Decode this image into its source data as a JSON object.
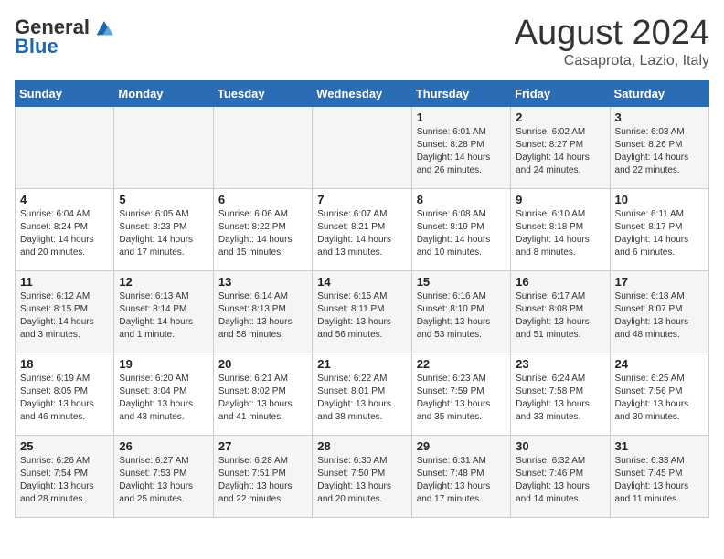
{
  "logo": {
    "general": "General",
    "blue": "Blue"
  },
  "title": "August 2024",
  "subtitle": "Casaprota, Lazio, Italy",
  "days_header": [
    "Sunday",
    "Monday",
    "Tuesday",
    "Wednesday",
    "Thursday",
    "Friday",
    "Saturday"
  ],
  "weeks": [
    [
      {
        "num": "",
        "info": ""
      },
      {
        "num": "",
        "info": ""
      },
      {
        "num": "",
        "info": ""
      },
      {
        "num": "",
        "info": ""
      },
      {
        "num": "1",
        "info": "Sunrise: 6:01 AM\nSunset: 8:28 PM\nDaylight: 14 hours and 26 minutes."
      },
      {
        "num": "2",
        "info": "Sunrise: 6:02 AM\nSunset: 8:27 PM\nDaylight: 14 hours and 24 minutes."
      },
      {
        "num": "3",
        "info": "Sunrise: 6:03 AM\nSunset: 8:26 PM\nDaylight: 14 hours and 22 minutes."
      }
    ],
    [
      {
        "num": "4",
        "info": "Sunrise: 6:04 AM\nSunset: 8:24 PM\nDaylight: 14 hours and 20 minutes."
      },
      {
        "num": "5",
        "info": "Sunrise: 6:05 AM\nSunset: 8:23 PM\nDaylight: 14 hours and 17 minutes."
      },
      {
        "num": "6",
        "info": "Sunrise: 6:06 AM\nSunset: 8:22 PM\nDaylight: 14 hours and 15 minutes."
      },
      {
        "num": "7",
        "info": "Sunrise: 6:07 AM\nSunset: 8:21 PM\nDaylight: 14 hours and 13 minutes."
      },
      {
        "num": "8",
        "info": "Sunrise: 6:08 AM\nSunset: 8:19 PM\nDaylight: 14 hours and 10 minutes."
      },
      {
        "num": "9",
        "info": "Sunrise: 6:10 AM\nSunset: 8:18 PM\nDaylight: 14 hours and 8 minutes."
      },
      {
        "num": "10",
        "info": "Sunrise: 6:11 AM\nSunset: 8:17 PM\nDaylight: 14 hours and 6 minutes."
      }
    ],
    [
      {
        "num": "11",
        "info": "Sunrise: 6:12 AM\nSunset: 8:15 PM\nDaylight: 14 hours and 3 minutes."
      },
      {
        "num": "12",
        "info": "Sunrise: 6:13 AM\nSunset: 8:14 PM\nDaylight: 14 hours and 1 minute."
      },
      {
        "num": "13",
        "info": "Sunrise: 6:14 AM\nSunset: 8:13 PM\nDaylight: 13 hours and 58 minutes."
      },
      {
        "num": "14",
        "info": "Sunrise: 6:15 AM\nSunset: 8:11 PM\nDaylight: 13 hours and 56 minutes."
      },
      {
        "num": "15",
        "info": "Sunrise: 6:16 AM\nSunset: 8:10 PM\nDaylight: 13 hours and 53 minutes."
      },
      {
        "num": "16",
        "info": "Sunrise: 6:17 AM\nSunset: 8:08 PM\nDaylight: 13 hours and 51 minutes."
      },
      {
        "num": "17",
        "info": "Sunrise: 6:18 AM\nSunset: 8:07 PM\nDaylight: 13 hours and 48 minutes."
      }
    ],
    [
      {
        "num": "18",
        "info": "Sunrise: 6:19 AM\nSunset: 8:05 PM\nDaylight: 13 hours and 46 minutes."
      },
      {
        "num": "19",
        "info": "Sunrise: 6:20 AM\nSunset: 8:04 PM\nDaylight: 13 hours and 43 minutes."
      },
      {
        "num": "20",
        "info": "Sunrise: 6:21 AM\nSunset: 8:02 PM\nDaylight: 13 hours and 41 minutes."
      },
      {
        "num": "21",
        "info": "Sunrise: 6:22 AM\nSunset: 8:01 PM\nDaylight: 13 hours and 38 minutes."
      },
      {
        "num": "22",
        "info": "Sunrise: 6:23 AM\nSunset: 7:59 PM\nDaylight: 13 hours and 35 minutes."
      },
      {
        "num": "23",
        "info": "Sunrise: 6:24 AM\nSunset: 7:58 PM\nDaylight: 13 hours and 33 minutes."
      },
      {
        "num": "24",
        "info": "Sunrise: 6:25 AM\nSunset: 7:56 PM\nDaylight: 13 hours and 30 minutes."
      }
    ],
    [
      {
        "num": "25",
        "info": "Sunrise: 6:26 AM\nSunset: 7:54 PM\nDaylight: 13 hours and 28 minutes."
      },
      {
        "num": "26",
        "info": "Sunrise: 6:27 AM\nSunset: 7:53 PM\nDaylight: 13 hours and 25 minutes."
      },
      {
        "num": "27",
        "info": "Sunrise: 6:28 AM\nSunset: 7:51 PM\nDaylight: 13 hours and 22 minutes."
      },
      {
        "num": "28",
        "info": "Sunrise: 6:30 AM\nSunset: 7:50 PM\nDaylight: 13 hours and 20 minutes."
      },
      {
        "num": "29",
        "info": "Sunrise: 6:31 AM\nSunset: 7:48 PM\nDaylight: 13 hours and 17 minutes."
      },
      {
        "num": "30",
        "info": "Sunrise: 6:32 AM\nSunset: 7:46 PM\nDaylight: 13 hours and 14 minutes."
      },
      {
        "num": "31",
        "info": "Sunrise: 6:33 AM\nSunset: 7:45 PM\nDaylight: 13 hours and 11 minutes."
      }
    ]
  ]
}
